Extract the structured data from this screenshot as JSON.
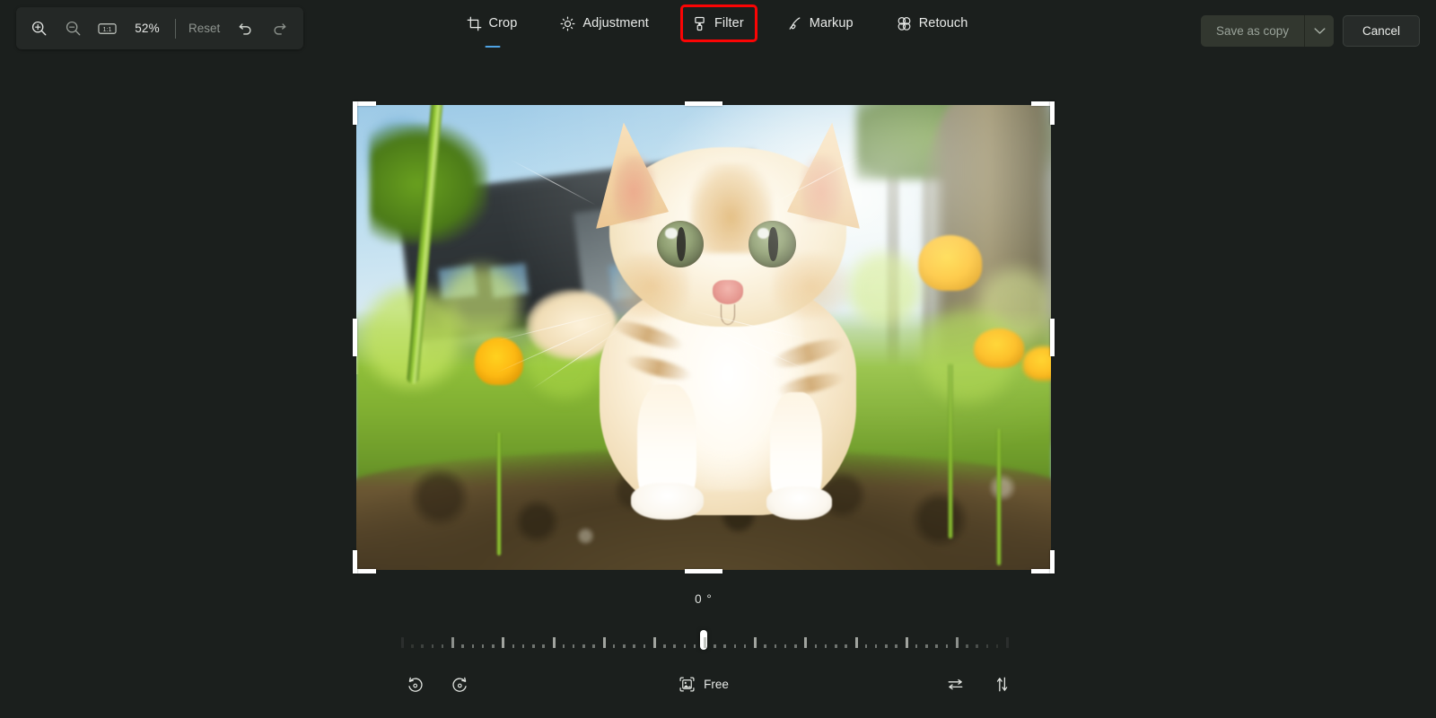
{
  "app": {
    "background_color": "#1b1f1d",
    "accent_color": "#4fa3e3",
    "highlight_color": "#fb0404"
  },
  "zoom_toolbar": {
    "zoom_in": {
      "label": "Zoom in",
      "icon": "zoom-in-icon"
    },
    "zoom_out": {
      "label": "Zoom out",
      "icon": "zoom-out-icon"
    },
    "actual_size": {
      "label": "1:1",
      "icon": "actual-size-icon"
    },
    "zoom_level": "52%",
    "reset_label": "Reset",
    "undo": {
      "label": "Undo",
      "icon": "undo-icon"
    },
    "redo": {
      "label": "Redo",
      "icon": "redo-icon"
    }
  },
  "tabs": [
    {
      "label": "Crop",
      "icon": "crop-icon",
      "active": true,
      "highlighted": false
    },
    {
      "label": "Adjustment",
      "icon": "brightness-icon",
      "active": false,
      "highlighted": false
    },
    {
      "label": "Filter",
      "icon": "filter-icon",
      "active": false,
      "highlighted": true
    },
    {
      "label": "Markup",
      "icon": "pen-icon",
      "active": false,
      "highlighted": false
    },
    {
      "label": "Retouch",
      "icon": "retouch-icon",
      "active": false,
      "highlighted": false
    }
  ],
  "top_right": {
    "save_label": "Save as copy",
    "save_dropdown_icon": "chevron-down-icon",
    "cancel_label": "Cancel"
  },
  "canvas": {
    "image_alt": "Orange and white kitten standing on dirt among grass and dandelions",
    "crop_handles": [
      "top-left",
      "top-center",
      "top-right",
      "middle-left",
      "middle-right",
      "bottom-left",
      "bottom-center",
      "bottom-right"
    ]
  },
  "rotation": {
    "value_label": "0 °",
    "value": 0,
    "min": -45,
    "max": 45,
    "major_tick_every": 5,
    "total_ticks": 61
  },
  "bottom_toolbar": {
    "rotate_left": {
      "label": "Rotate left",
      "icon": "rotate-left-icon"
    },
    "rotate_right": {
      "label": "Rotate right",
      "icon": "rotate-right-icon"
    },
    "aspect_ratio": {
      "label": "Free",
      "icon": "aspect-ratio-icon"
    },
    "flip_horizontal": {
      "label": "Flip horizontal",
      "icon": "flip-horizontal-icon"
    },
    "flip_vertical": {
      "label": "Flip vertical",
      "icon": "flip-vertical-icon"
    }
  }
}
